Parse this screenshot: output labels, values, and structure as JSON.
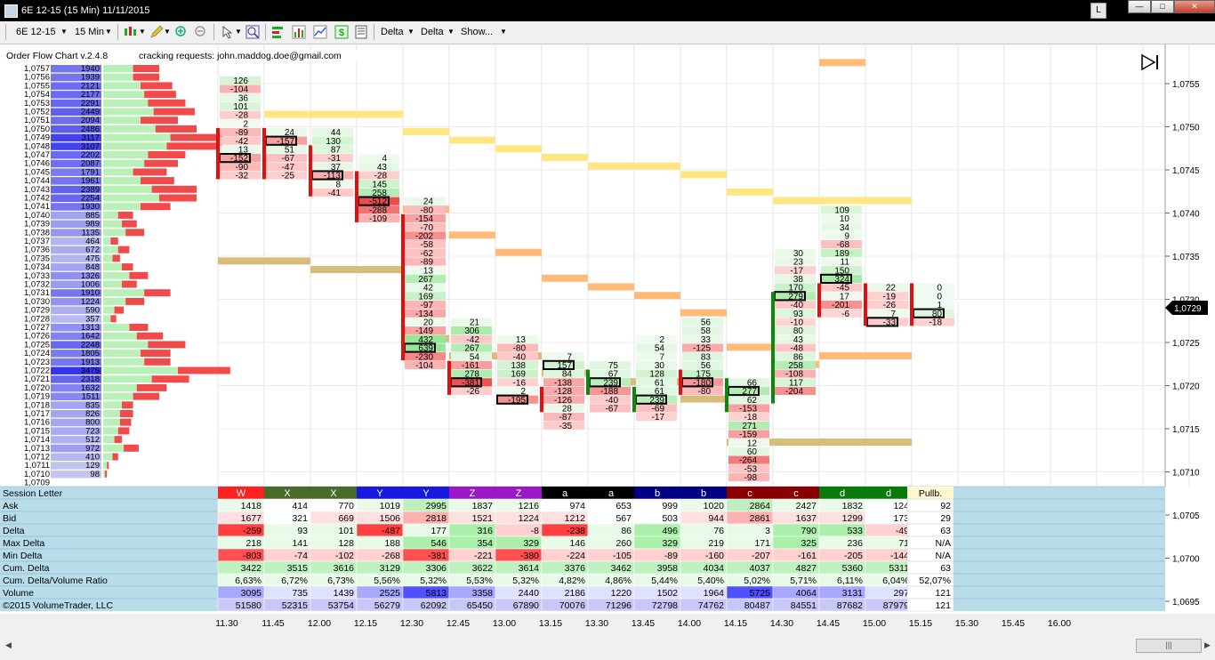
{
  "window": {
    "title": "6E 12-15 (15 Min)  11/11/2015",
    "l_button": "L",
    "min_glyph": "—",
    "max_glyph": "□",
    "close_glyph": "✕"
  },
  "toolbar": {
    "instrument": "6E 12-15",
    "interval": "15 Min",
    "delta1": "Delta",
    "delta2": "Delta",
    "show": "Show..."
  },
  "overlay": {
    "version": "Order Flow Chart v.2.4.8",
    "cracking": "cracking requests: john.maddog.doe@gmail.com",
    "copyright": "©2015 VolumeTrader, LLC"
  },
  "price_axis": {
    "labels": [
      "1,0755",
      "1,0750",
      "1,0745",
      "1,0740",
      "1,0735",
      "1,0730",
      "1,0725",
      "1,0720",
      "1,0715",
      "1,0710",
      "1,0705",
      "1,0700",
      "1,0695"
    ],
    "current_price": "1,0729"
  },
  "time_axis": {
    "labels": [
      "11.30",
      "11.45",
      "12.00",
      "12.15",
      "12.30",
      "12.45",
      "13.00",
      "13.15",
      "13.30",
      "13.45",
      "14.00",
      "14.15",
      "14.30",
      "14.45",
      "15.00",
      "15.15",
      "15.30",
      "15.45",
      "16.00"
    ]
  },
  "profile": {
    "prices": [
      "1,0757",
      "1,0756",
      "1,0755",
      "1,0754",
      "1,0753",
      "1,0752",
      "1,0751",
      "1,0750",
      "1,0749",
      "1,0748",
      "1,0747",
      "1,0746",
      "1,0745",
      "1,0744",
      "1,0743",
      "1,0742",
      "1,0741",
      "1,0740",
      "1,0739",
      "1,0738",
      "1,0737",
      "1,0736",
      "1,0735",
      "1,0734",
      "1,0733",
      "1,0732",
      "1,0731",
      "1,0730",
      "1,0729",
      "1,0728",
      "1,0727",
      "1,0726",
      "1,0725",
      "1,0724",
      "1,0723",
      "1,0722",
      "1,0721",
      "1,0720",
      "1,0719",
      "1,0718",
      "1,0717",
      "1,0716",
      "1,0715",
      "1,0714",
      "1,0713",
      "1,0712",
      "1,0711",
      "1,0710",
      "1,0709"
    ],
    "volumes": [
      "1940",
      "1939",
      "2121",
      "2177",
      "2291",
      "2449",
      "2094",
      "2486",
      "3117",
      "3107",
      "2202",
      "2087",
      "1791",
      "1961",
      "2389",
      "2254",
      "1930",
      "885",
      "989",
      "1135",
      "464",
      "672",
      "475",
      "848",
      "1326",
      "1006",
      "1910",
      "1224",
      "590",
      "357",
      "1313",
      "1642",
      "2248",
      "1805",
      "1913",
      "3475",
      "2318",
      "1632",
      "1511",
      "835",
      "826",
      "800",
      "723",
      "512",
      "972",
      "410",
      "129",
      "98",
      ""
    ],
    "ask_pct": [
      0.16,
      0.16,
      0.2,
      0.22,
      0.24,
      0.27,
      0.2,
      0.28,
      0.36,
      0.34,
      0.24,
      0.22,
      0.16,
      0.2,
      0.26,
      0.3,
      0.2,
      0.08,
      0.1,
      0.12,
      0.04,
      0.08,
      0.05,
      0.1,
      0.14,
      0.1,
      0.22,
      0.12,
      0.06,
      0.04,
      0.14,
      0.18,
      0.24,
      0.2,
      0.22,
      0.4,
      0.26,
      0.18,
      0.16,
      0.1,
      0.09,
      0.09,
      0.08,
      0.06,
      0.11,
      0.05,
      0.02,
      0.01,
      0
    ],
    "bid_pct": [
      0.14,
      0.14,
      0.17,
      0.17,
      0.2,
      0.22,
      0.2,
      0.22,
      0.28,
      0.3,
      0.2,
      0.18,
      0.18,
      0.18,
      0.24,
      0.2,
      0.16,
      0.08,
      0.08,
      0.1,
      0.04,
      0.06,
      0.04,
      0.06,
      0.1,
      0.08,
      0.14,
      0.1,
      0.05,
      0.03,
      0.1,
      0.14,
      0.2,
      0.16,
      0.14,
      0.28,
      0.2,
      0.16,
      0.14,
      0.06,
      0.07,
      0.06,
      0.06,
      0.04,
      0.08,
      0.03,
      0.01,
      0.01,
      0
    ]
  },
  "bars": [
    {
      "cells": [
        {
          "p": 1.0756,
          "v": "126"
        },
        {
          "p": 1.0755,
          "v": "-104"
        },
        {
          "p": 1.0754,
          "v": "36"
        },
        {
          "p": 1.0753,
          "v": "101"
        },
        {
          "p": 1.0752,
          "v": "-28"
        },
        {
          "p": 1.0751,
          "v": "2"
        },
        {
          "p": 1.075,
          "v": "-89"
        },
        {
          "p": 1.0749,
          "v": "-42"
        },
        {
          "p": 1.0748,
          "v": "13"
        },
        {
          "p": 1.0747,
          "v": "-152"
        },
        {
          "p": 1.0746,
          "v": "-90"
        },
        {
          "p": 1.0745,
          "v": "-32"
        }
      ],
      "box": 1.0747,
      "candle": [
        1.075,
        1.0745
      ],
      "up": false
    },
    {
      "cells": [
        {
          "p": 1.075,
          "v": "24"
        },
        {
          "p": 1.0749,
          "v": "-157"
        },
        {
          "p": 1.0748,
          "v": "51"
        },
        {
          "p": 1.0747,
          "v": "-67"
        },
        {
          "p": 1.0746,
          "v": "-47"
        },
        {
          "p": 1.0745,
          "v": "-25"
        }
      ],
      "box": 1.0749,
      "candle": [
        1.075,
        1.0745
      ],
      "up": false
    },
    {
      "cells": [
        {
          "p": 1.075,
          "v": "44"
        },
        {
          "p": 1.0749,
          "v": "130"
        },
        {
          "p": 1.0748,
          "v": "87"
        },
        {
          "p": 1.0747,
          "v": "-31"
        },
        {
          "p": 1.0746,
          "v": "37"
        },
        {
          "p": 1.0745,
          "v": "-113"
        },
        {
          "p": 1.0744,
          "v": "8"
        },
        {
          "p": 1.0743,
          "v": "-41"
        }
      ],
      "box": 1.0745,
      "candle": [
        1.0748,
        1.0743
      ],
      "up": false
    },
    {
      "cells": [
        {
          "p": 1.0747,
          "v": "4"
        },
        {
          "p": 1.0746,
          "v": "43"
        },
        {
          "p": 1.0745,
          "v": "-28"
        },
        {
          "p": 1.0744,
          "v": "145"
        },
        {
          "p": 1.0743,
          "v": "258"
        },
        {
          "p": 1.0742,
          "v": "-512"
        },
        {
          "p": 1.0741,
          "v": "-288"
        },
        {
          "p": 1.074,
          "v": "-109"
        }
      ],
      "box": 1.0742,
      "candle": [
        1.0745,
        1.074
      ],
      "up": false
    },
    {
      "cells": [
        {
          "p": 1.0742,
          "v": "24"
        },
        {
          "p": 1.0741,
          "v": "-80"
        },
        {
          "p": 1.074,
          "v": "-154"
        },
        {
          "p": 1.0739,
          "v": "-70"
        },
        {
          "p": 1.0738,
          "v": "-202"
        },
        {
          "p": 1.0737,
          "v": "-58"
        },
        {
          "p": 1.0736,
          "v": "-62"
        },
        {
          "p": 1.0735,
          "v": "-89"
        },
        {
          "p": 1.0734,
          "v": "13"
        },
        {
          "p": 1.0733,
          "v": "267"
        },
        {
          "p": 1.0732,
          "v": "42"
        },
        {
          "p": 1.0731,
          "v": "169"
        },
        {
          "p": 1.073,
          "v": "-97"
        },
        {
          "p": 1.0729,
          "v": "-134"
        },
        {
          "p": 1.0728,
          "v": "20"
        },
        {
          "p": 1.0727,
          "v": "-149"
        },
        {
          "p": 1.0726,
          "v": "432"
        },
        {
          "p": 1.0725,
          "v": "639"
        },
        {
          "p": 1.0724,
          "v": "-230"
        },
        {
          "p": 1.0723,
          "v": "-104"
        }
      ],
      "box": 1.0725,
      "candle": [
        1.074,
        1.0724
      ],
      "up": false
    },
    {
      "cells": [
        {
          "p": 1.0728,
          "v": "21"
        },
        {
          "p": 1.0727,
          "v": "306"
        },
        {
          "p": 1.0726,
          "v": "-42"
        },
        {
          "p": 1.0725,
          "v": "267"
        },
        {
          "p": 1.0724,
          "v": "54"
        },
        {
          "p": 1.0723,
          "v": "-161"
        },
        {
          "p": 1.0722,
          "v": "278"
        },
        {
          "p": 1.0721,
          "v": "-381"
        },
        {
          "p": 1.072,
          "v": "-26"
        }
      ],
      "box": 1.0721,
      "candle": [
        1.0723,
        1.072
      ],
      "up": false
    },
    {
      "cells": [
        {
          "p": 1.0726,
          "v": "13"
        },
        {
          "p": 1.0725,
          "v": "-80"
        },
        {
          "p": 1.0724,
          "v": "-40"
        },
        {
          "p": 1.0723,
          "v": "138"
        },
        {
          "p": 1.0722,
          "v": "169"
        },
        {
          "p": 1.0721,
          "v": "-16"
        },
        {
          "p": 1.072,
          "v": "2"
        },
        {
          "p": 1.0719,
          "v": "-195"
        }
      ],
      "box": 1.0719,
      "candle": null,
      "up": false
    },
    {
      "cells": [
        {
          "p": 1.0724,
          "v": "7"
        },
        {
          "p": 1.0723,
          "v": "157"
        },
        {
          "p": 1.0722,
          "v": "84"
        },
        {
          "p": 1.0721,
          "v": "-138"
        },
        {
          "p": 1.072,
          "v": "-128"
        },
        {
          "p": 1.0719,
          "v": "-126"
        },
        {
          "p": 1.0718,
          "v": "28"
        },
        {
          "p": 1.0717,
          "v": "-87"
        },
        {
          "p": 1.0716,
          "v": "-35"
        }
      ],
      "box": 1.0723,
      "candle": [
        1.072,
        1.0718
      ],
      "up": false
    },
    {
      "cells": [
        {
          "p": 1.0723,
          "v": "75"
        },
        {
          "p": 1.0722,
          "v": "67"
        },
        {
          "p": 1.0721,
          "v": "239"
        },
        {
          "p": 1.072,
          "v": "-188"
        },
        {
          "p": 1.0719,
          "v": "-40"
        },
        {
          "p": 1.0718,
          "v": "-67"
        }
      ],
      "box": 1.0721,
      "candle": [
        1.0722,
        1.072
      ],
      "up": true
    },
    {
      "cells": [
        {
          "p": 1.0726,
          "v": "2"
        },
        {
          "p": 1.0725,
          "v": "54"
        },
        {
          "p": 1.0724,
          "v": "7"
        },
        {
          "p": 1.0723,
          "v": "30"
        },
        {
          "p": 1.0722,
          "v": "128"
        },
        {
          "p": 1.0721,
          "v": "61"
        },
        {
          "p": 1.072,
          "v": "61"
        },
        {
          "p": 1.0719,
          "v": "239"
        },
        {
          "p": 1.0718,
          "v": "-69"
        },
        {
          "p": 1.0717,
          "v": "-17"
        }
      ],
      "box": 1.0719,
      "candle": [
        1.072,
        1.0718
      ],
      "up": true
    },
    {
      "cells": [
        {
          "p": 1.0728,
          "v": "56"
        },
        {
          "p": 1.0727,
          "v": "58"
        },
        {
          "p": 1.0726,
          "v": "33"
        },
        {
          "p": 1.0725,
          "v": "-125"
        },
        {
          "p": 1.0724,
          "v": "83"
        },
        {
          "p": 1.0723,
          "v": "56"
        },
        {
          "p": 1.0722,
          "v": "175"
        },
        {
          "p": 1.0721,
          "v": "-180"
        },
        {
          "p": 1.072,
          "v": "-80"
        }
      ],
      "box": 1.0721,
      "candle": [
        1.0722,
        1.072
      ],
      "up": false
    },
    {
      "cells": [
        {
          "p": 1.0721,
          "v": "66"
        },
        {
          "p": 1.072,
          "v": "277"
        },
        {
          "p": 1.0719,
          "v": "62"
        },
        {
          "p": 1.0718,
          "v": "-153"
        },
        {
          "p": 1.0717,
          "v": "-18"
        },
        {
          "p": 1.0716,
          "v": "271"
        },
        {
          "p": 1.0715,
          "v": "-159"
        },
        {
          "p": 1.0714,
          "v": "12"
        },
        {
          "p": 1.0713,
          "v": "60"
        },
        {
          "p": 1.0712,
          "v": "-264"
        },
        {
          "p": 1.0711,
          "v": "-53"
        },
        {
          "p": 1.071,
          "v": "-98"
        }
      ],
      "box": 1.072,
      "candle": [
        1.0721,
        1.0718
      ],
      "up": true
    },
    {
      "cells": [
        {
          "p": 1.0736,
          "v": "30"
        },
        {
          "p": 1.0735,
          "v": "23"
        },
        {
          "p": 1.0734,
          "v": "-17"
        },
        {
          "p": 1.0733,
          "v": "38"
        },
        {
          "p": 1.0732,
          "v": "170"
        },
        {
          "p": 1.0731,
          "v": "279"
        },
        {
          "p": 1.073,
          "v": "-40"
        },
        {
          "p": 1.0729,
          "v": "93"
        },
        {
          "p": 1.0728,
          "v": "-10"
        },
        {
          "p": 1.0727,
          "v": "80"
        },
        {
          "p": 1.0726,
          "v": "43"
        },
        {
          "p": 1.0725,
          "v": "-48"
        },
        {
          "p": 1.0724,
          "v": "86"
        },
        {
          "p": 1.0723,
          "v": "258"
        },
        {
          "p": 1.0722,
          "v": "-108"
        },
        {
          "p": 1.0721,
          "v": "117"
        },
        {
          "p": 1.072,
          "v": "-204"
        }
      ],
      "box": 1.0731,
      "candle": [
        1.0731,
        1.0719
      ],
      "up": true
    },
    {
      "cells": [
        {
          "p": 1.0741,
          "v": "109"
        },
        {
          "p": 1.074,
          "v": "10"
        },
        {
          "p": 1.0739,
          "v": "34"
        },
        {
          "p": 1.0738,
          "v": "9"
        },
        {
          "p": 1.0737,
          "v": "-68"
        },
        {
          "p": 1.0736,
          "v": "189"
        },
        {
          "p": 1.0735,
          "v": "11"
        },
        {
          "p": 1.0734,
          "v": "150"
        },
        {
          "p": 1.0733,
          "v": "324"
        },
        {
          "p": 1.0732,
          "v": "-45"
        },
        {
          "p": 1.0731,
          "v": "17"
        },
        {
          "p": 1.073,
          "v": "-201"
        },
        {
          "p": 1.0729,
          "v": "-6"
        }
      ],
      "box": 1.0733,
      "candle": [
        1.0732,
        1.0729
      ],
      "up": false
    },
    {
      "cells": [
        {
          "p": 1.0732,
          "v": "22"
        },
        {
          "p": 1.0731,
          "v": "-19"
        },
        {
          "p": 1.073,
          "v": "-26"
        },
        {
          "p": 1.0729,
          "v": "7"
        },
        {
          "p": 1.0728,
          "v": "-33"
        }
      ],
      "box": 1.0728,
      "candle": [
        1.0732,
        1.0728
      ],
      "up": false
    },
    {
      "cells": [
        {
          "p": 1.0732,
          "v": "0"
        },
        {
          "p": 1.0731,
          "v": "0"
        },
        {
          "p": 1.073,
          "v": "1"
        },
        {
          "p": 1.0729,
          "v": "80"
        },
        {
          "p": 1.0728,
          "v": "-18"
        }
      ],
      "box": 1.0729,
      "candle": [
        1.0732,
        1.0728
      ],
      "up": false
    }
  ],
  "table": {
    "row_labels": [
      "Session Letter",
      "Ask",
      "Bid",
      "Delta",
      "Max Delta",
      "Min Delta",
      "Cum. Delta",
      "Cum. Delta/Volume Ratio",
      "Volume",
      ""
    ],
    "letters": [
      "W",
      "X",
      "X",
      "Y",
      "Y",
      "Z",
      "Z",
      "a",
      "a",
      "b",
      "b",
      "c",
      "c",
      "d",
      "d"
    ],
    "letter_colors": [
      "#ff2020",
      "#4a6a2a",
      "#4a6a2a",
      "#1818e0",
      "#1818e0",
      "#9a18c8",
      "#9a18c8",
      "#000000",
      "#000000",
      "#000080",
      "#000080",
      "#8a0000",
      "#8a0000",
      "#0a7a0a",
      "#0a7a0a"
    ],
    "rows": [
      [
        "1418",
        "414",
        "770",
        "1019",
        "2995",
        "1837",
        "1216",
        "974",
        "653",
        "999",
        "1020",
        "2864",
        "2427",
        "1832",
        "124"
      ],
      [
        "1677",
        "321",
        "669",
        "1506",
        "2818",
        "1521",
        "1224",
        "1212",
        "567",
        "503",
        "944",
        "2861",
        "1637",
        "1299",
        "173"
      ],
      [
        "-259",
        "93",
        "101",
        "-487",
        "177",
        "316",
        "-8",
        "-238",
        "86",
        "496",
        "76",
        "3",
        "790",
        "533",
        "-49"
      ],
      [
        "218",
        "141",
        "128",
        "188",
        "546",
        "354",
        "329",
        "146",
        "260",
        "329",
        "219",
        "171",
        "325",
        "236",
        "71"
      ],
      [
        "-803",
        "-74",
        "-102",
        "-268",
        "-381",
        "-221",
        "-380",
        "-224",
        "-105",
        "-89",
        "-160",
        "-207",
        "-161",
        "-205",
        "-144"
      ],
      [
        "3422",
        "3515",
        "3616",
        "3129",
        "3306",
        "3622",
        "3614",
        "3376",
        "3462",
        "3958",
        "4034",
        "4037",
        "4827",
        "5360",
        "5311"
      ],
      [
        "6,63%",
        "6,72%",
        "6,73%",
        "5,56%",
        "5,32%",
        "5,53%",
        "5,32%",
        "4,82%",
        "4,86%",
        "5,44%",
        "5,40%",
        "5,02%",
        "5,71%",
        "6,11%",
        "6,04%"
      ],
      [
        "3095",
        "735",
        "1439",
        "2525",
        "5813",
        "3358",
        "2440",
        "2186",
        "1220",
        "1502",
        "1964",
        "5725",
        "4064",
        "3131",
        "297"
      ],
      [
        "51580",
        "52315",
        "53754",
        "56279",
        "62092",
        "65450",
        "67890",
        "70076",
        "71296",
        "72798",
        "74762",
        "80487",
        "84551",
        "87682",
        "87979"
      ]
    ],
    "pullb_header": "Pullb.",
    "pullb": [
      "92",
      "29",
      "63",
      "N/A",
      "N/A",
      "63",
      "52,07%",
      "121",
      "121"
    ]
  }
}
